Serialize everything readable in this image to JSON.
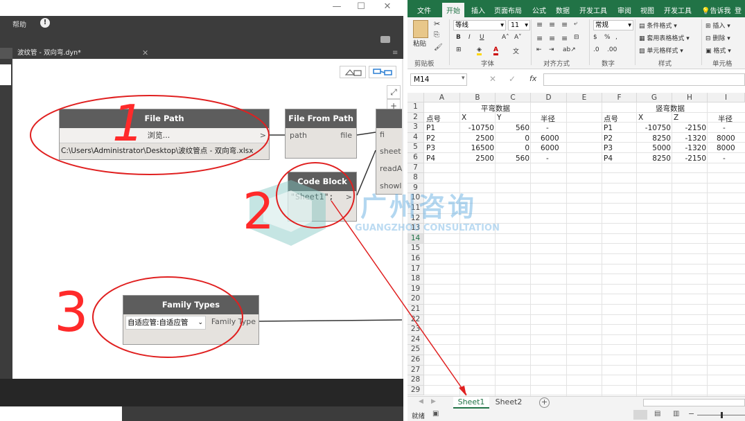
{
  "dynamo": {
    "window_controls": {
      "minimize": "—",
      "maximize": "☐",
      "close": "✕"
    },
    "menu_help": "帮助",
    "menu_info": "!",
    "tab_title": "波纹管 - 双向弯.dyn*",
    "tab_close": "✕",
    "nodes": {
      "file_path": {
        "title": "File Path",
        "browse": "浏览...",
        "out_port": ">",
        "path_value": "C:\\Users\\Administrator\\Desktop\\波纹管点 - 双向弯.xlsx"
      },
      "file_from_path": {
        "title": "File From Path",
        "in_port": "path",
        "out_port": "file"
      },
      "import_excel": {
        "ports": [
          "fi",
          "sheet",
          "readA",
          "showl"
        ]
      },
      "code_block": {
        "title": "Code Block",
        "code": "\"Sheet1\";",
        "out_port": ">"
      },
      "family_types": {
        "title": "Family Types",
        "selected": "自适应管:自适应管",
        "out_port": "Family Type"
      }
    },
    "canvas_controls": [
      "⤢",
      "+",
      "−",
      "✥"
    ]
  },
  "annotations": {
    "one": "1",
    "two": "2",
    "three": "3"
  },
  "watermark": {
    "cn": "广州咨询",
    "en": "GUANGZHOU CONSULTATION"
  },
  "excel": {
    "tabs": [
      "文件",
      "开始",
      "插入",
      "页面布局",
      "公式",
      "数据",
      "开发工具",
      "审阅",
      "视图",
      "开发工具",
      "告诉我",
      "登"
    ],
    "active_tab": "开始",
    "ribbon": {
      "paste": "粘贴",
      "font_name": "等线",
      "font_size": "11",
      "number_format": "常规",
      "conditional": "条件格式",
      "table_format": "套用表格格式",
      "cell_style": "单元格样式",
      "insert": "插入",
      "delete": "删除",
      "format": "格式",
      "groups": [
        "剪贴板",
        "字体",
        "对齐方式",
        "数字",
        "样式",
        "单元格"
      ]
    },
    "name_box": "M14",
    "fx": "fx",
    "columns": [
      "A",
      "B",
      "C",
      "D",
      "E",
      "F",
      "G",
      "H",
      "I"
    ],
    "rows": [
      "1",
      "2",
      "3",
      "4",
      "5",
      "6",
      "7",
      "8",
      "9",
      "10",
      "11",
      "12",
      "13",
      "14",
      "15",
      "16",
      "17",
      "18",
      "19",
      "20",
      "21",
      "22",
      "23",
      "24",
      "25",
      "26",
      "27",
      "28",
      "29"
    ],
    "cells": {
      "b1": "平弯数据",
      "g1": "竖弯数据",
      "a2": "点号",
      "b2": "X",
      "c2": "Y",
      "d2": "半径",
      "f2": "点号",
      "g2": "X",
      "h2": "Z",
      "i2": "半径",
      "a3": "P1",
      "b3": "-10750",
      "c3": "560",
      "d3": "-",
      "f3": "P1",
      "g3": "-10750",
      "h3": "-2150",
      "i3": "-",
      "a4": "P2",
      "b4": "2500",
      "c4": "0",
      "d4": "6000",
      "f4": "P2",
      "g4": "8250",
      "h4": "-1320",
      "i4": "8000",
      "a5": "P3",
      "b5": "16500",
      "c5": "0",
      "d5": "6000",
      "f5": "P3",
      "g5": "5000",
      "h5": "-1320",
      "i5": "8000",
      "a6": "P4",
      "b6": "2500",
      "c6": "560",
      "d6": "-",
      "f6": "P4",
      "g6": "8250",
      "h6": "-2150",
      "i6": "-"
    },
    "sheets": [
      "Sheet1",
      "Sheet2"
    ],
    "active_sheet": "Sheet1",
    "add_sheet": "+",
    "status": "就绪"
  }
}
